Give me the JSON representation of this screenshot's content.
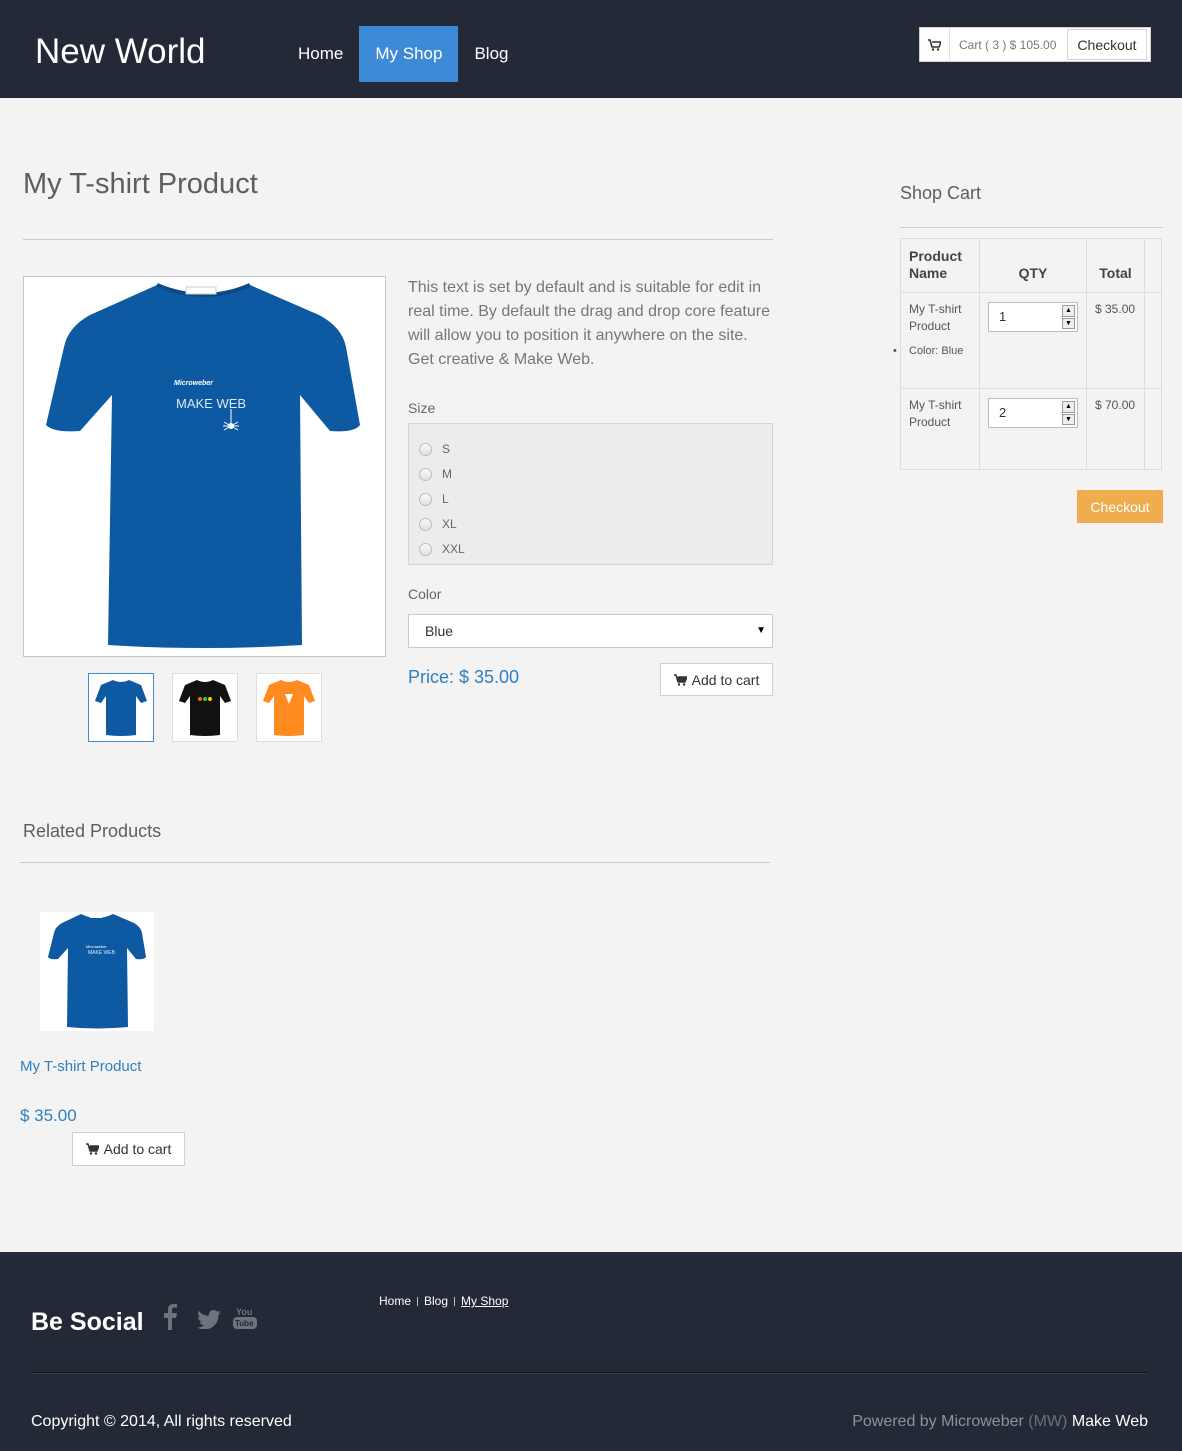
{
  "header": {
    "logo": "New World",
    "nav": [
      "Home",
      "My Shop",
      "Blog"
    ],
    "active_nav": "My Shop",
    "cart_summary": "Cart ( 3 ) $ 105.00",
    "checkout_label": "Checkout"
  },
  "product": {
    "title": "My T-shirt Product",
    "description": "This text is set by default and is suitable for edit in real time. By default the drag and drop core feature will allow you to position it anywhere on the site. Get creative & Make Web.",
    "size_label": "Size",
    "sizes": [
      "S",
      "M",
      "L",
      "XL",
      "XXL"
    ],
    "color_label": "Color",
    "color_value": "Blue",
    "price": "Price: $ 35.00",
    "add_to_cart": "Add to cart",
    "image_text_small": "Microweber",
    "image_text_big": "MAKE WEB",
    "thumbnail_colors": [
      "#0d5aa3",
      "#111111",
      "#ff8a1f"
    ]
  },
  "shop_cart": {
    "title": "Shop Cart",
    "headers": [
      "Product Name",
      "QTY",
      "Total"
    ],
    "rows": [
      {
        "name": "My T-shirt Product",
        "option": "Color: Blue",
        "qty": "1",
        "total": "$ 35.00"
      },
      {
        "name": "My T-shirt Product",
        "option": "",
        "qty": "2",
        "total": "$ 70.00"
      }
    ],
    "checkout_label": "Checkout"
  },
  "related": {
    "title": "Related Products",
    "items": [
      {
        "name": "My T-shirt Product",
        "price": "$ 35.00",
        "add_label": "Add to cart"
      }
    ]
  },
  "footer": {
    "be_social": "Be Social",
    "social_icons": [
      "facebook-icon",
      "twitter-icon",
      "youtube-icon"
    ],
    "links": [
      "Home",
      "Blog",
      "My Shop"
    ],
    "copyright": "Copyright © 2014, All rights reserved",
    "powered_prefix": "Powered by Microweber",
    "powered_mw": "(MW)",
    "powered_make": "Make Web"
  },
  "colors": {
    "header_bg": "#232936",
    "accent": "#3d8ad6",
    "price_blue": "#2f7fc1",
    "checkout_orange": "#f0ad4e",
    "shirt_blue": "#0d5aa3"
  }
}
